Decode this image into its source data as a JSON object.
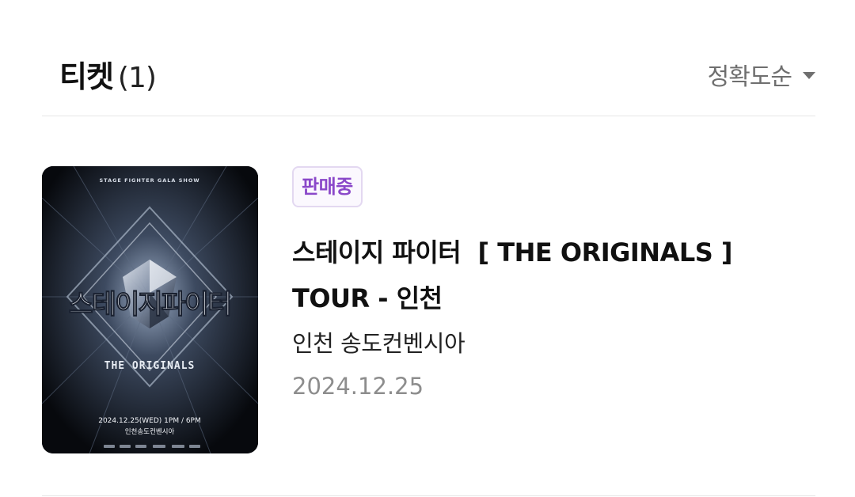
{
  "header": {
    "title": "티켓",
    "count": "(1)",
    "sort_label": "정확도순"
  },
  "tickets": [
    {
      "status_badge": "판매중",
      "title_line1": "스테이지 파이터  [ THE ORIGINALS ]",
      "title_line2": "TOUR - 인천",
      "venue": "인천 송도컨벤시아",
      "date": "2024.12.25",
      "poster": {
        "top_text": "STAGE FIGHTER  GALA SHOW",
        "main_text": "스테이지파이터",
        "sub_text": "THE ORIGINALS",
        "date_text": "2024.12.25(WED) 1PM / 6PM",
        "venue_text": "인천송도컨벤시아"
      }
    }
  ],
  "colors": {
    "badge_text": "#8a48c9",
    "badge_border": "#e3d8f1",
    "date_text": "#8d8d8d",
    "sort_text": "#6f6f6f"
  }
}
